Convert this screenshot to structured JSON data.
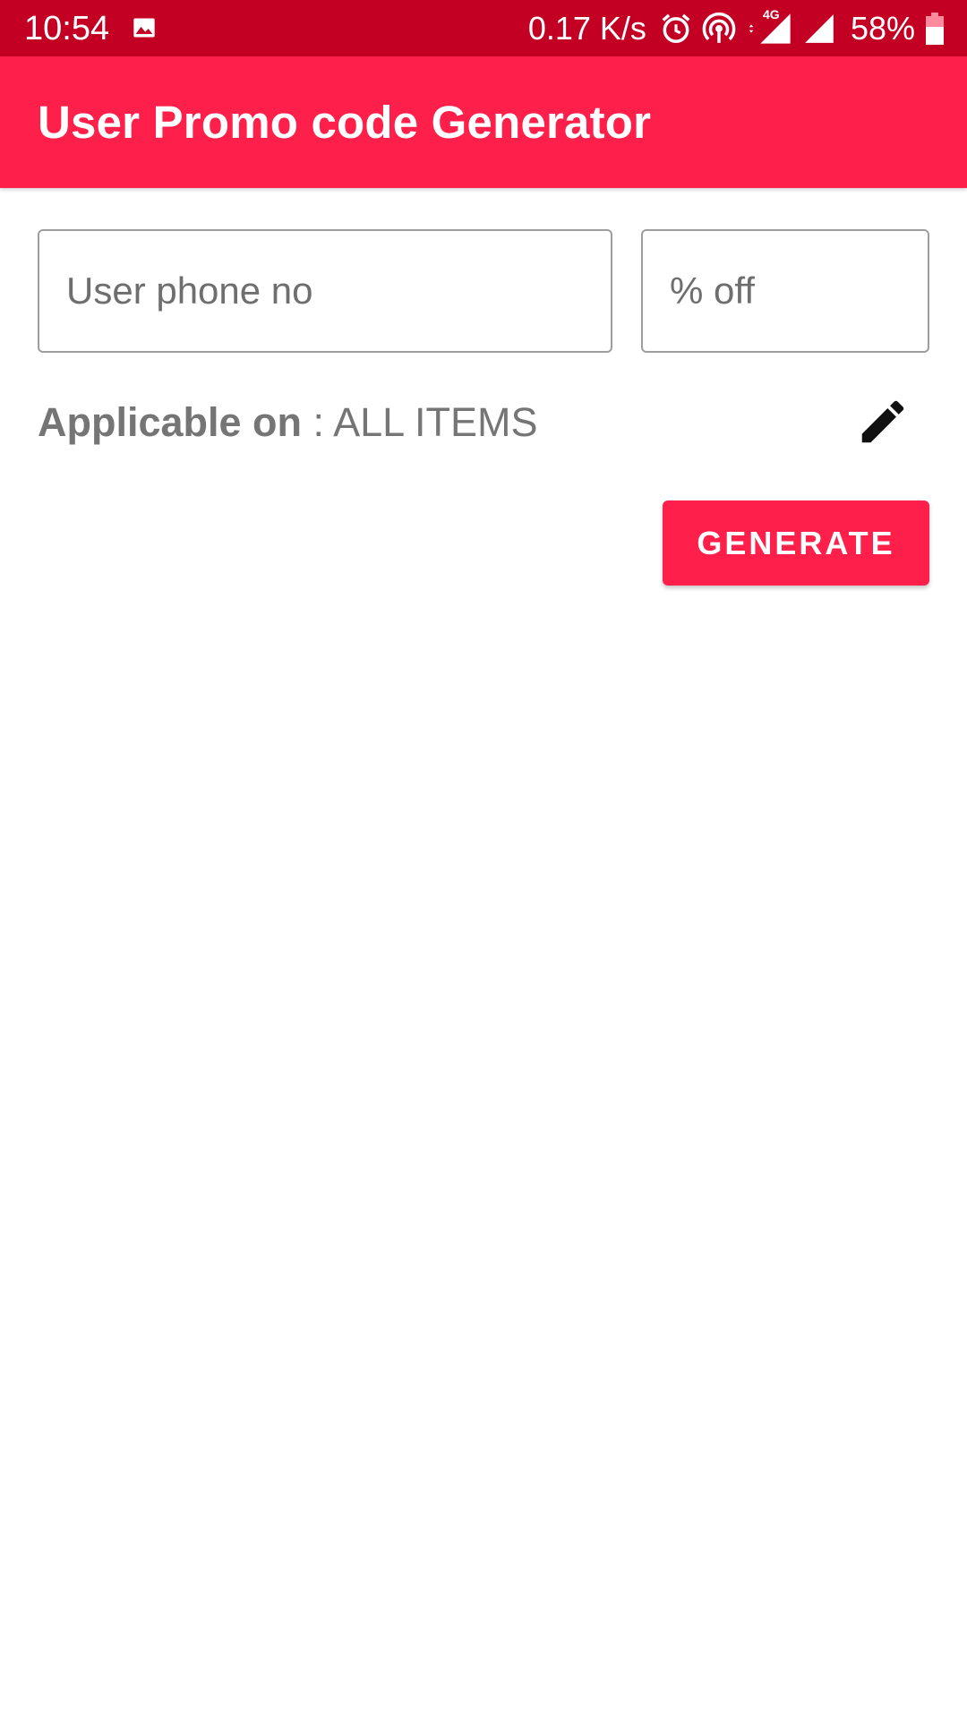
{
  "status_bar": {
    "time": "10:54",
    "net_speed": "0.17 K/s",
    "network_type": "4G",
    "battery": "58%",
    "icons": [
      "gallery-icon",
      "alarm-icon",
      "hotspot-icon",
      "data-arrows-icon",
      "signal-icon",
      "battery-icon"
    ]
  },
  "app_bar": {
    "title": "User Promo code Generator",
    "color": "#ff1f4b"
  },
  "form": {
    "phone": {
      "placeholder": "User phone no",
      "value": ""
    },
    "discount": {
      "placeholder": "% off",
      "value": ""
    },
    "applicable_label": "Applicable on",
    "applicable_value": ": ALL ITEMS",
    "edit_icon": "pencil-icon",
    "generate_label": "GENERATE"
  },
  "colors": {
    "status_bar": "#c30024",
    "accent": "#ff1f4b",
    "text_gray": "#757575"
  }
}
